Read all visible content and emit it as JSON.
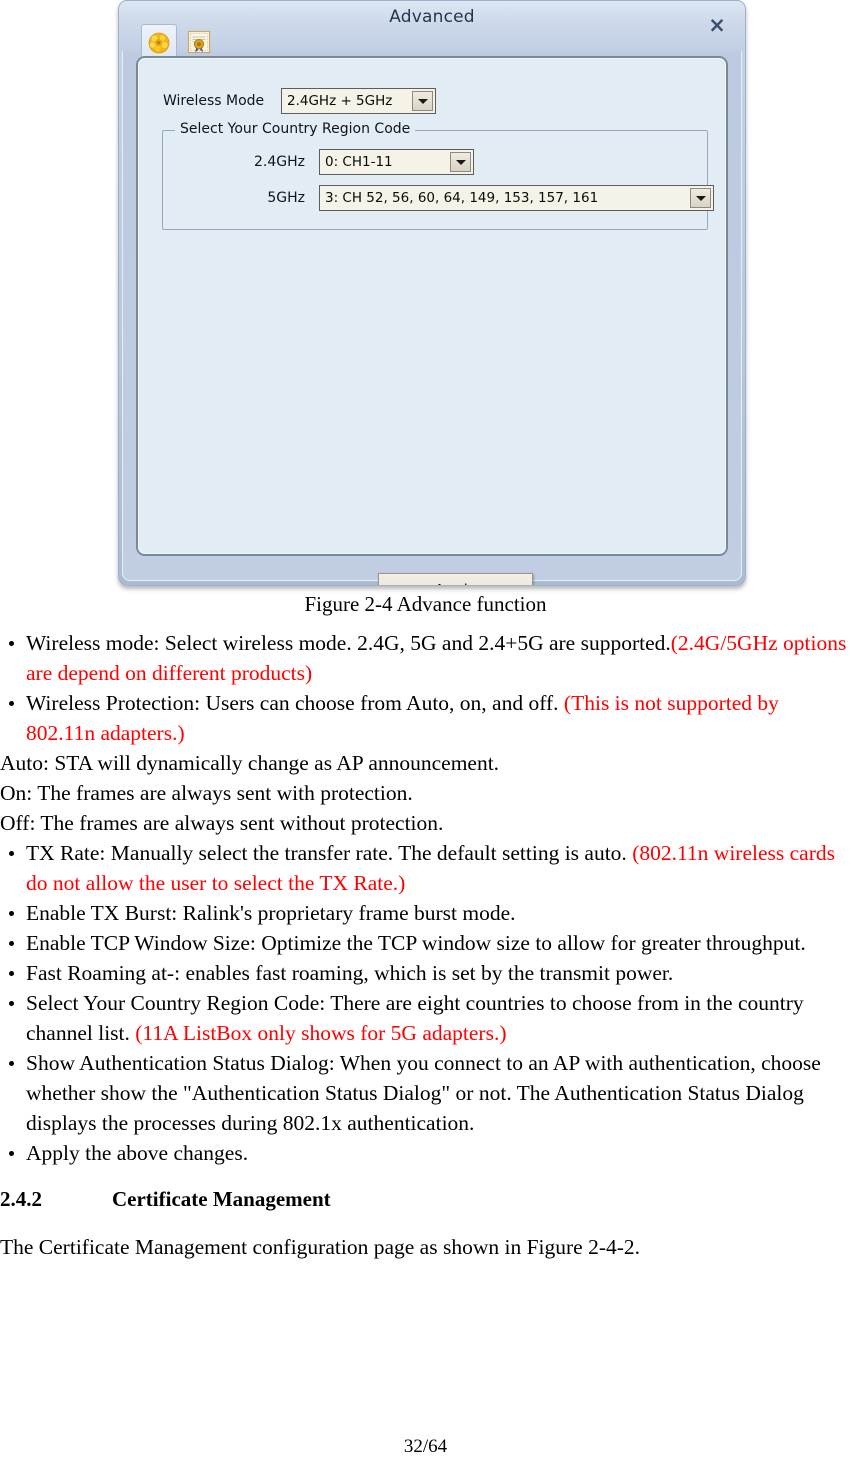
{
  "dialog": {
    "title": "Advanced",
    "close_label": "×",
    "tabs": [
      {
        "name": "advanced",
        "icon": "gear-flower-icon",
        "selected": true
      },
      {
        "name": "certificate",
        "icon": "certificate-seal-icon",
        "selected": false
      }
    ],
    "wireless_mode": {
      "label": "Wireless Mode",
      "value": "2.4GHz + 5GHz"
    },
    "country_region_group": {
      "title": "Select Your Country Region Code",
      "rows": [
        {
          "label": "2.4GHz",
          "value": "0: CH1-11"
        },
        {
          "label": "5GHz",
          "value": "3:  CH  52,  56,  60,  64, 149, 153, 157, 161"
        }
      ]
    },
    "apply_label": "Apply"
  },
  "figure_caption": "Figure 2-4 Advance function",
  "body": {
    "bullets_1": [
      {
        "black": "Wireless mode: Select wireless mode. 2.4G, 5G and 2.4+5G are supported.",
        "red": "(2.4G/5GHz options are depend on different products)"
      },
      {
        "black": "Wireless Protection: Users can choose from Auto, on, and off. ",
        "red": "(This is not supported by 802.11n adapters.)"
      }
    ],
    "paragraphs": [
      "Auto: STA will dynamically change as AP announcement.",
      "On: The frames are always sent with protection.",
      "Off: The frames are always sent without protection."
    ],
    "bullets_2": [
      {
        "black": "TX Rate: Manually select the transfer rate. The default setting is auto. ",
        "red": "(802.11n wireless cards do not allow the user to select the TX Rate.)"
      },
      {
        "black": "Enable TX Burst: Ralink's proprietary frame burst mode.",
        "red": ""
      },
      {
        "black": "Enable TCP Window Size: Optimize the TCP window size to allow for greater throughput.",
        "red": ""
      },
      {
        "black": "Fast Roaming at-: enables fast roaming, which is set by the transmit power.",
        "red": ""
      },
      {
        "black": "Select Your Country Region Code: There are eight countries to choose from in the country channel list. ",
        "red": "(11A ListBox only shows for 5G adapters.)"
      },
      {
        "black": "Show Authentication Status Dialog: When you connect to an AP with authentication, choose whether show the \"Authentication Status Dialog\" or not. The Authentication Status Dialog displays the processes during 802.1x authentication.",
        "red": ""
      },
      {
        "black": "Apply the above changes.",
        "red": ""
      }
    ],
    "heading": {
      "number": "2.4.2",
      "text": "Certificate Management"
    },
    "closing_paragraph": "The Certificate Management configuration page as shown in Figure 2-4-2."
  },
  "footer": {
    "page": "32/64"
  }
}
